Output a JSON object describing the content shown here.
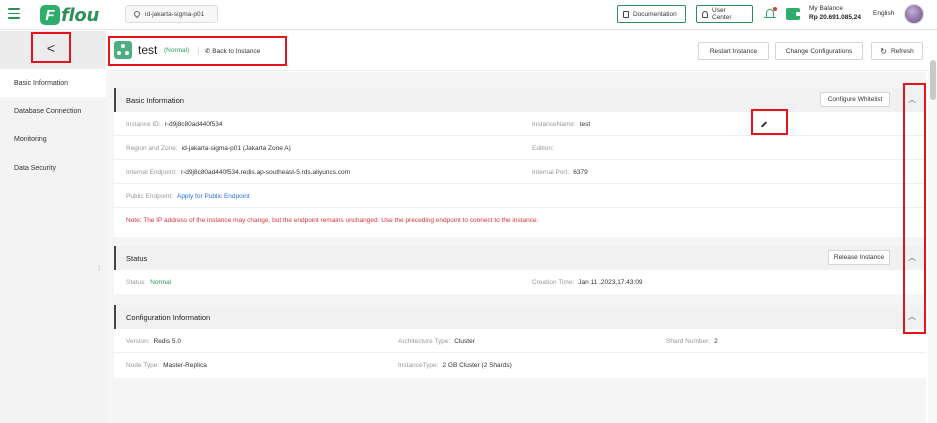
{
  "topbar": {
    "logo_text": "flou",
    "region": "id-jakarta-sigma-p01",
    "documentation": "Documentation",
    "user_center": "User Center",
    "balance_label": "My Balance",
    "balance_amount": "Rp 20.691.085,24",
    "language": "English"
  },
  "sidebar": {
    "back_glyph": "<",
    "items": [
      "Basic Information",
      "Database Connection",
      "Monitoring",
      "Data Security"
    ],
    "active_index": 0
  },
  "header": {
    "instance_name": "test",
    "status": "(Normal)",
    "back_link": "Back to Instance",
    "buttons": {
      "restart": "Restart Instance",
      "change": "Change Configurations",
      "refresh": "Refresh"
    }
  },
  "basic_info": {
    "title": "Basic Information",
    "whitelist_button": "Configure Whitelist",
    "instance_id_label": "Instance ID:",
    "instance_id": "r-d9j8c80ad440f534",
    "instance_name_label": "InstanceName:",
    "instance_name": "test",
    "region_label": "Region and Zone:",
    "region_value": "id-jakarta-sigma-p01 (Jakarta Zone A)",
    "edition_label": "Edition:",
    "edition_value": "",
    "internal_endpoint_label": "Internal Endpoint:",
    "internal_endpoint": "r-d9j8c80ad440f534.redis.ap-southeast-5.rds.aliyuncs.com",
    "internal_port_label": "Internal Port:",
    "internal_port": "6379",
    "public_endpoint_label": "Public Endpoint:",
    "public_endpoint_link": "Apply for Public Endpoint",
    "note": "Note:  The IP address of the instance may change, but the endpoint remains unchanged. Use the preceding endpoint to connect to the instance."
  },
  "status_panel": {
    "title": "Status",
    "release_button": "Release Instance",
    "status_label": "Status:",
    "status_value": "Normal",
    "creation_label": "Creation Time:",
    "creation_value": "Jan 11 ,2023,17:43:09"
  },
  "config_panel": {
    "title": "Configuration Information",
    "version_label": "Version:",
    "version_value": "Redis 5.0",
    "arch_label": "Architecture Type:",
    "arch_value": "Cluster",
    "shard_label": "Shard Number:",
    "shard_value": "2",
    "node_label": "Node Type:",
    "node_value": "Master-Replica",
    "instancetype_label": "InstanceType:",
    "instancetype_value": "2 GB Cluster (2 Shards)"
  },
  "colors": {
    "brand_green": "#2fae6b",
    "status_green": "#2e9d57",
    "link_blue": "#2a6fd6",
    "note_red": "#d9343a",
    "annotation_red": "#e3141b"
  },
  "icons": [
    "menu-icon",
    "location-pin-icon",
    "document-icon",
    "user-icon",
    "bell-icon",
    "wallet-icon",
    "chevron-left-icon",
    "phone-icon",
    "refresh-icon",
    "edit-icon",
    "chevron-up-icon",
    "collapse-handle-icon"
  ]
}
